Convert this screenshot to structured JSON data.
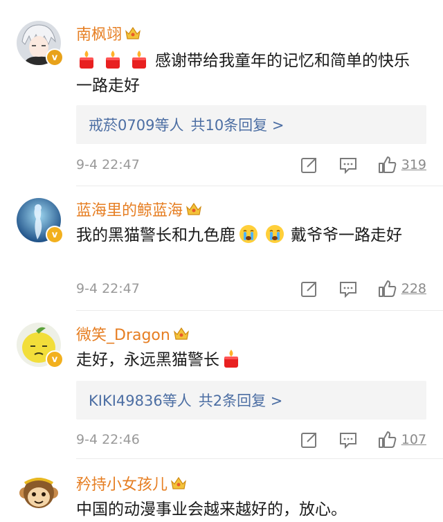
{
  "comments": [
    {
      "username": "南枫翊",
      "text": "感谢带给我童年的记忆和简单的快乐 一路走好",
      "emoji_prefix": [
        "candle-emoji",
        "candle-emoji",
        "candle-emoji"
      ],
      "reply": {
        "users": "戒菸0709等人",
        "count_text": "共10条回复 >"
      },
      "time": "9-4 22:47",
      "likes": "319",
      "badge_color": "#e8a21a",
      "avatar_style": "anime-white-hair"
    },
    {
      "username": "蓝海里的鲸蓝海",
      "text_before": "我的黑猫警长和九色鹿",
      "text_after": "戴爷爷一路走好",
      "inline_emojis": [
        "crying-emoji",
        "crying-emoji"
      ],
      "time": "9-4 22:47",
      "likes": "228",
      "badge_color": "#f2b01e",
      "avatar_style": "blue-ocean-figure"
    },
    {
      "username": "微笑_Dragon",
      "text": "走好，永远黑猫警长",
      "emoji_suffix": "candle-emoji",
      "reply": {
        "users": "KIKI49836等人",
        "count_text": "共2条回复 >"
      },
      "time": "9-4 22:46",
      "likes": "107",
      "badge_color": "#f2b01e",
      "avatar_style": "yellow-lemon-face"
    },
    {
      "username": "矜持小女孩儿",
      "text": "中国的动漫事业会越来越好的，放心。",
      "avatar_style": "monkey-king-cartoon"
    }
  ],
  "colors": {
    "username": "#e67e22",
    "link": "#4c6ea3",
    "reply_bg": "#f4f4f4",
    "meta": "#999999"
  }
}
